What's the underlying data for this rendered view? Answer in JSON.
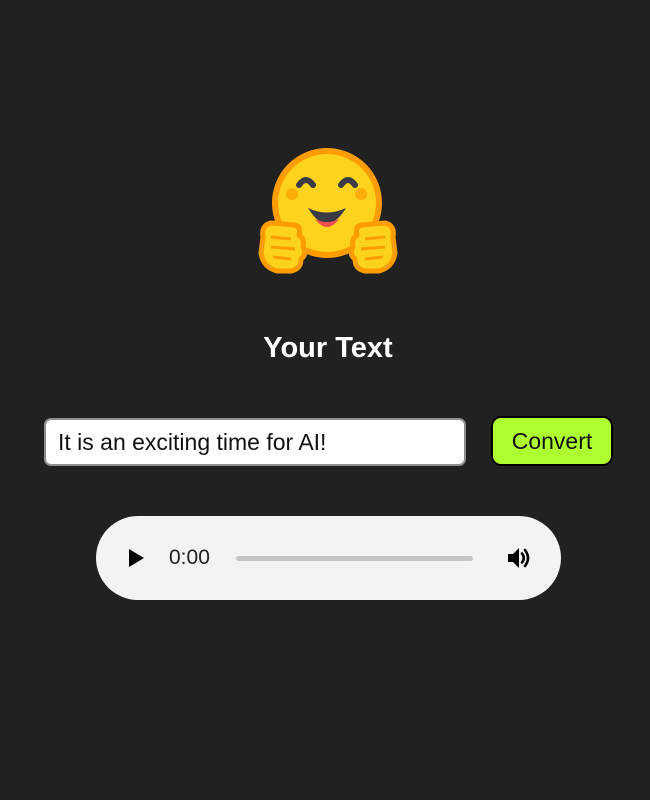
{
  "logo": {
    "icon": "hugging-face-emoji-icon"
  },
  "header": {
    "title": "Your Text"
  },
  "form": {
    "input_value": "It is an exciting time for AI!",
    "convert_label": "Convert",
    "convert_color": "#adff2f"
  },
  "audio": {
    "time": "0:00",
    "progress": 0,
    "play_icon": "play-icon",
    "volume_icon": "volume-icon"
  },
  "colors": {
    "background": "#212121",
    "title_text": "#ffffff",
    "player_background": "#f1f3f4"
  }
}
